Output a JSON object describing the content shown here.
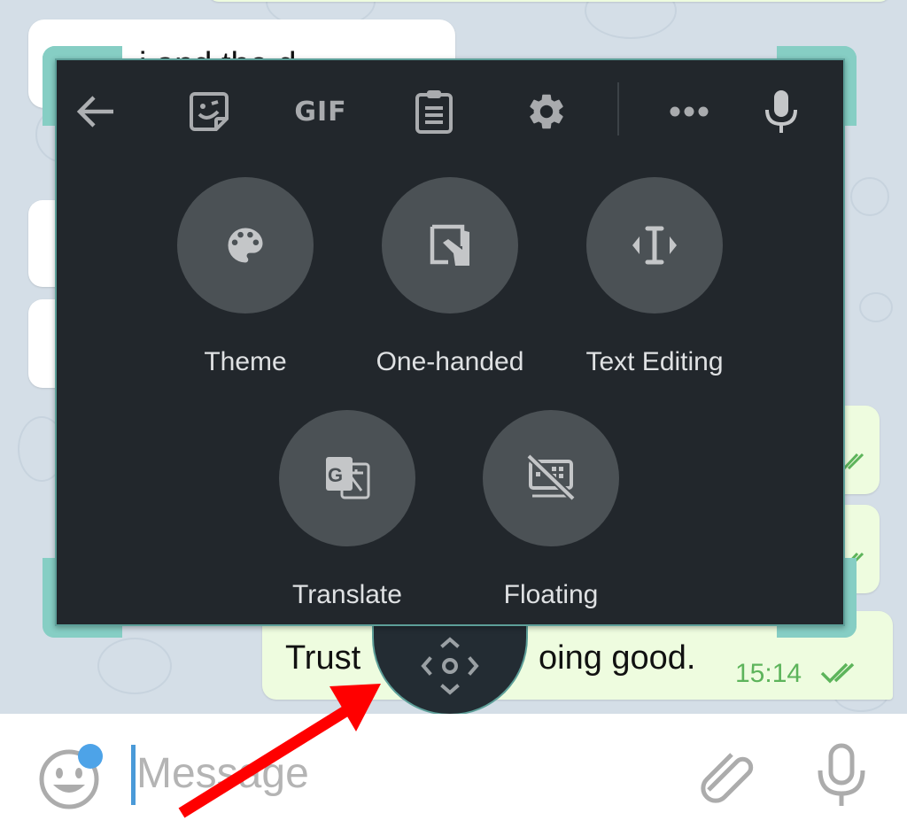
{
  "chat": {
    "messages": [
      {
        "direction": "incoming",
        "text": "i and the d",
        "partial": true
      },
      {
        "direction": "incoming",
        "text": "",
        "partial": true
      },
      {
        "direction": "incoming",
        "text": "",
        "partial": true
      },
      {
        "direction": "outgoing",
        "text": "",
        "partial": true
      },
      {
        "direction": "outgoing",
        "text": "",
        "partial": true
      },
      {
        "direction": "outgoing",
        "text_left": "Trust",
        "text_right": "oing good.",
        "time": "15:14",
        "status": "read"
      }
    ]
  },
  "keyboard": {
    "toolbar": [
      {
        "name": "back",
        "icon": "arrow-left-icon"
      },
      {
        "name": "sticker",
        "icon": "sticker-icon"
      },
      {
        "name": "gif",
        "label": "GIF"
      },
      {
        "name": "clipboard",
        "icon": "clipboard-icon"
      },
      {
        "name": "settings",
        "icon": "gear-icon"
      },
      {
        "name": "more",
        "icon": "more-horizontal-icon"
      },
      {
        "name": "voice",
        "icon": "mic-icon"
      }
    ],
    "features": [
      {
        "label": "Theme",
        "icon": "palette-icon"
      },
      {
        "label": "One-handed",
        "icon": "one-handed-icon"
      },
      {
        "label": "Text Editing",
        "icon": "text-cursor-icon"
      },
      {
        "label": "Translate",
        "icon": "translate-icon"
      },
      {
        "label": "Floating",
        "icon": "floating-keyboard-off-icon"
      }
    ],
    "drag_handle_icon": "move-icon"
  },
  "input_bar": {
    "placeholder": "Message",
    "emoji_icon": "smiley-icon",
    "attach_icon": "paperclip-icon",
    "mic_icon": "mic-icon",
    "has_notification_dot": true
  },
  "annotation": {
    "type": "arrow",
    "color": "#ff0000",
    "points_to": "drag-handle"
  },
  "colors": {
    "keyboard_bg": "#22272c",
    "feature_circle": "#4b5155",
    "frame_accent": "#86cec4",
    "outgoing_bubble": "#eefcdf",
    "time_green": "#5db45b",
    "caret_blue": "#4a9ad8"
  }
}
